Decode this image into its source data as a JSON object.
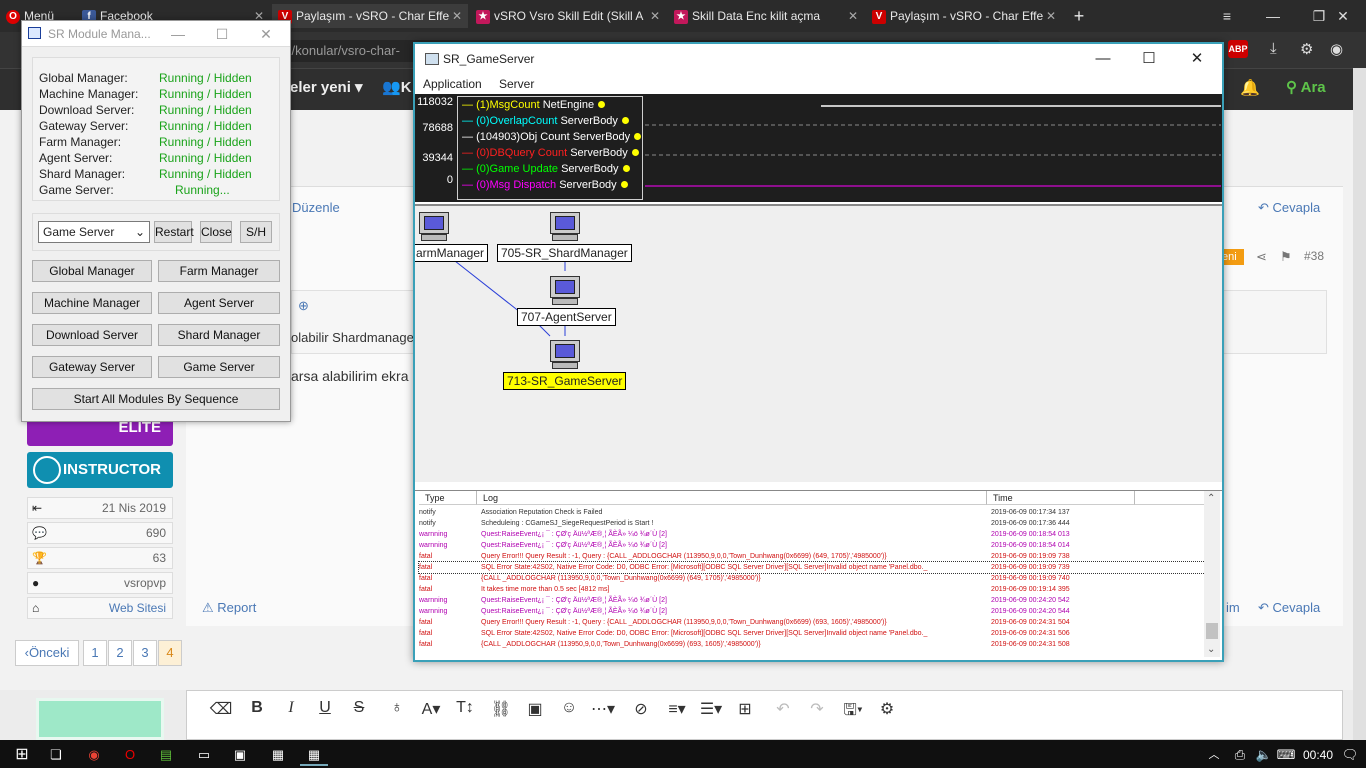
{
  "browser": {
    "tabs": [
      {
        "label": "Menü",
        "icon": "opera-icon"
      },
      {
        "label": "Facebook",
        "icon": "facebook-icon"
      },
      {
        "label": "Paylaşım - vSRO - Char Effe",
        "icon": "vsro-icon"
      },
      {
        "label": "vSRO Vsro Skill Edit (Skill A",
        "icon": "star-icon"
      },
      {
        "label": "Skill Data Enc kilit açma",
        "icon": "star-icon"
      },
      {
        "label": "Paylaşım - vSRO - Char Effe",
        "icon": "vsro-icon"
      }
    ],
    "address": "rg/konular/vsro-char-",
    "nav": {
      "item1": "eler yeni",
      "item2": "K",
      "search_label": "Ara"
    }
  },
  "forum": {
    "edit_link": "Düzenle",
    "reply_link": "Cevapla",
    "reply_link2": "Cevapla",
    "report_link": "Report",
    "post_number": "#38",
    "badge_new": "eni",
    "text1": "olabilir Shardmanage",
    "text2": "arsa alabilirim ekra",
    "im_fragment": "im",
    "badges": {
      "elite": "ELITE",
      "instructor": "INSTRUCTOR"
    },
    "stats": {
      "joined": "21 Nis 2019",
      "messages": "690",
      "trophies": "63",
      "location": "vsropvp",
      "website": "Web Sitesi"
    },
    "pagination": {
      "prev": "Önceki",
      "pages": [
        "1",
        "2",
        "3",
        "4"
      ]
    }
  },
  "module_manager": {
    "title": "SR Module Mana...",
    "servers": [
      {
        "name": "Global Manager:",
        "status": "Running / Hidden"
      },
      {
        "name": "Machine Manager:",
        "status": "Running / Hidden"
      },
      {
        "name": "Download Server:",
        "status": "Running / Hidden"
      },
      {
        "name": "Gateway Server:",
        "status": "Running / Hidden"
      },
      {
        "name": "Farm Manager:",
        "status": "Running / Hidden"
      },
      {
        "name": "Agent Server:",
        "status": "Running / Hidden"
      },
      {
        "name": "Shard Manager:",
        "status": "Running / Hidden"
      },
      {
        "name": "Game Server:",
        "status": "Running..."
      }
    ],
    "combo_value": "Game Server",
    "restart_label": "Restart",
    "close_label": "Close",
    "sh_label": "S/H",
    "buttons": [
      "Global Manager",
      "Farm Manager",
      "Machine Manager",
      "Agent Server",
      "Download Server",
      "Shard Manager",
      "Gateway Server",
      "Game Server"
    ],
    "start_all_label": "Start All Modules By Sequence"
  },
  "game_server": {
    "title": "SR_GameServer",
    "menu": [
      "Application",
      "Server"
    ],
    "graph": {
      "y_labels": [
        "118032",
        "78688",
        "39344",
        "0"
      ],
      "legend": [
        {
          "label": "(1)MsgCount",
          "suffix": "NetEngine",
          "color": "#ffff00"
        },
        {
          "label": "(0)OverlapCount",
          "suffix": "ServerBody",
          "color": "#00ffff"
        },
        {
          "label": "(104903)Obj Count",
          "suffix": "ServerBody",
          "color": "#ffffff"
        },
        {
          "label": "(0)DBQuery Count",
          "suffix": "ServerBody",
          "color": "#ff2020"
        },
        {
          "label": "(0)Game Update",
          "suffix": "ServerBody",
          "color": "#00ff00"
        },
        {
          "label": "(0)Msg Dispatch",
          "suffix": "ServerBody",
          "color": "#ff00ff"
        }
      ]
    },
    "nodes": {
      "farm": "armManager",
      "shard": "705-SR_ShardManager",
      "agent": "707-AgentServer",
      "game": "713-SR_GameServer"
    },
    "log_headers": {
      "type": "Type",
      "log": "Log",
      "time": "Time"
    },
    "logs": [
      {
        "type": "notify",
        "log": "Association Reputation Check is Failed",
        "time": "2019-06-09 00:17:34 137",
        "color": "#333333"
      },
      {
        "type": "notify",
        "log": "Scheduleing : CGameSJ_SiegeRequestPeriod is Start !",
        "time": "2019-06-09 00:17:36 444",
        "color": "#333333"
      },
      {
        "type": "warnning",
        "log": "Quest:RaiseEvent¿¡ ¯ : ÇØ'ç Äü½ªÆ®¸¦ ÃÈÃ» ¼ö ¾ø´Ù [2]",
        "time": "2019-06-09 00:18:54 013",
        "color": "#b000b0"
      },
      {
        "type": "warnning",
        "log": "Quest:RaiseEvent¿¡ ¯ : ÇØ'ç Äü½ªÆ®¸¦ ÃÈÃ» ¼ö ¾ø´Ù [2]",
        "time": "2019-06-09 00:18:54 014",
        "color": "#b000b0"
      },
      {
        "type": "fatal",
        "log": "Query Error!!! Query Result : -1, Query : {CALL _ADDLOGCHAR (113950,9,0,0,'Town_Dunhwang(0x6699) (649, 1705)','4985000')}",
        "time": "2019-06-09 00:19:09 738",
        "color": "#d01010"
      },
      {
        "type": "fatal",
        "log": "SQL Error State:42S02, Native Error Code: D0, ODBC Error: [Microsoft][ODBC SQL Server Driver][SQL Server]Invalid object name 'Panel.dbo._",
        "time": "2019-06-09 00:19:09 739",
        "color": "#d01010"
      },
      {
        "type": "fatal",
        "log": "{CALL _ADDLOGCHAR (113950,9,0,0,'Town_Dunhwang(0x6699) (649, 1705)','4985000')}",
        "time": "2019-06-09 00:19:09 740",
        "color": "#d01010"
      },
      {
        "type": "fatal",
        "log": "It takes time more than 0.5 sec [4812 ms]",
        "time": "2019-06-09 00:19:14 395",
        "color": "#d01010"
      },
      {
        "type": "warnning",
        "log": "Quest:RaiseEvent¿¡ ¯ : ÇØ'ç Äü½ªÆ®¸¦ ÃÈÃ» ¼ö ¾ø´Ù [2]",
        "time": "2019-06-09 00:24:20 542",
        "color": "#b000b0"
      },
      {
        "type": "warnning",
        "log": "Quest:RaiseEvent¿¡ ¯ : ÇØ'ç Äü½ªÆ®¸¦ ÃÈÃ» ¼ö ¾ø´Ù [2]",
        "time": "2019-06-09 00:24:20 544",
        "color": "#b000b0"
      },
      {
        "type": "fatal",
        "log": "Query Error!!! Query Result : -1, Query : {CALL _ADDLOGCHAR (113950,9,0,0,'Town_Dunhwang(0x6699) (693, 1605)','4985000')}",
        "time": "2019-06-09 00:24:31 504",
        "color": "#d01010"
      },
      {
        "type": "fatal",
        "log": "SQL Error State:42S02, Native Error Code: D0, ODBC Error: [Microsoft][ODBC SQL Server Driver][SQL Server]Invalid object name 'Panel.dbo._",
        "time": "2019-06-09 00:24:31 506",
        "color": "#d01010"
      },
      {
        "type": "fatal",
        "log": "{CALL _ADDLOGCHAR (113950,9,0,0,'Town_Dunhwang(0x6699) (693, 1605)','4985000')}",
        "time": "2019-06-09 00:24:31 508",
        "color": "#d01010"
      }
    ]
  },
  "taskbar": {
    "clock": "00:40"
  }
}
